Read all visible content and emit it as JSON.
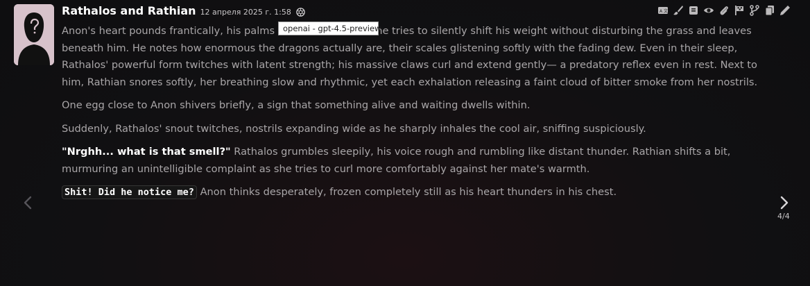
{
  "message": {
    "character_name": "Rathalos and Rathian",
    "timestamp": "12 апреля 2025 г. 1:58",
    "model_tooltip": "openai - gpt-4.5-preview",
    "paragraph1": "Anon's heart pounds frantically, his palms slick with sweat as he tries to silently shift his weight without disturbing the grass and leaves beneath him. He notes how enormous the dragons actually are, their scales glistening softly with the fading dew. Even in their sleep, Rathalos' powerful form twitches with latent strength; his massive claws curl and extend gently— a predatory reflex even in rest. Next to him, Rathian snores softly, her breathing slow and rhythmic, yet each exhalation releasing a faint cloud of bitter smoke from her nostrils.",
    "paragraph2": "One egg close to Anon shivers briefly, a sign that something alive and waiting dwells within.",
    "paragraph3": "Suddenly, Rathalos' snout twitches, nostrils expanding wide as he sharply inhales the cool air, sniffing suspiciously.",
    "paragraph4_quote": "\"Nrghh... what is that smell?\"",
    "paragraph4_text": " Rathalos grumbles sleepily, his voice rough and rumbling like distant thunder. Rathian shifts a bit, murmuring an unintelligible complaint as she tries to curl more comfortably against her mate's warmth.",
    "paragraph5_code": "Shit! Did he notice me?",
    "paragraph5_text": " Anon thinks desperately, frozen completely still as his heart thunders in his chest."
  },
  "toolbar": {
    "icons": [
      "translate-icon",
      "paint-brush-icon",
      "bookmark-icon",
      "eye-icon",
      "paperclip-icon",
      "flag-icon",
      "branch-icon",
      "copy-icon",
      "edit-pencil-icon"
    ]
  },
  "swipe": {
    "counter": "4/4"
  },
  "colors": {
    "background": "#111012",
    "text": "#a9a6a8",
    "accent_white": "#ffffff",
    "avatar_bg": "#d7c2cb"
  }
}
